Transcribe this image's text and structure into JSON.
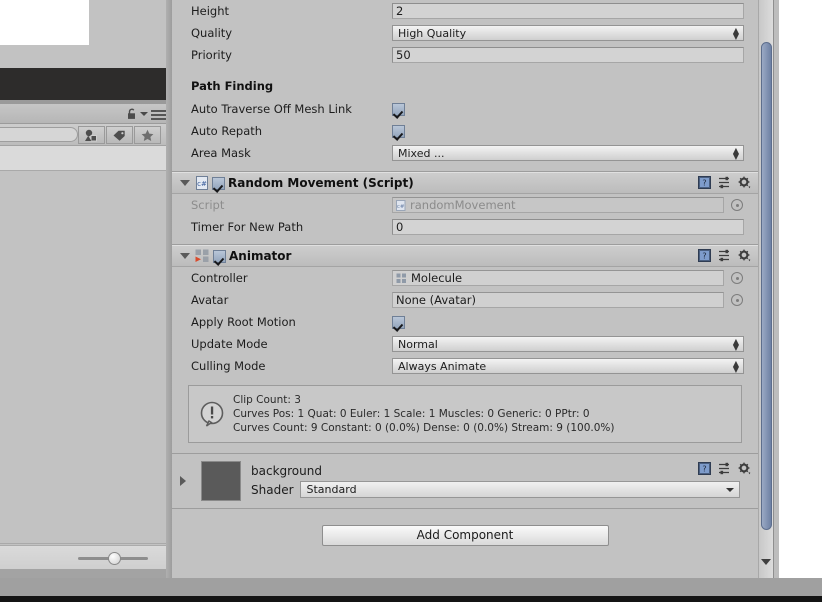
{
  "nav_mesh_agent": {
    "fields": [
      {
        "label": "Height",
        "type": "text",
        "value": "2"
      },
      {
        "label": "Quality",
        "type": "dropdown",
        "value": "High Quality"
      },
      {
        "label": "Priority",
        "type": "text",
        "value": "50"
      }
    ],
    "path_finding": {
      "section_title": "Path Finding",
      "fields": [
        {
          "label": "Auto Traverse Off Mesh Link",
          "type": "checkbox",
          "value": true
        },
        {
          "label": "Auto Repath",
          "type": "checkbox",
          "value": true
        },
        {
          "label": "Area Mask",
          "type": "dropdown",
          "value": "Mixed ..."
        }
      ]
    }
  },
  "random_movement": {
    "title": "Random Movement (Script)",
    "enabled": true,
    "icon": "csharp-script-icon",
    "fields": [
      {
        "label": "Script",
        "type": "object",
        "value": "randomMovement",
        "disabled": true
      },
      {
        "label": "Timer For New Path",
        "type": "text",
        "value": "0"
      }
    ]
  },
  "animator": {
    "title": "Animator",
    "enabled": true,
    "icon": "animator-icon",
    "fields": [
      {
        "label": "Controller",
        "type": "object",
        "value": "Molecule"
      },
      {
        "label": "Avatar",
        "type": "object",
        "value": "None (Avatar)"
      },
      {
        "label": "Apply Root Motion",
        "type": "checkbox",
        "value": true
      },
      {
        "label": "Update Mode",
        "type": "dropdown",
        "value": "Normal"
      },
      {
        "label": "Culling Mode",
        "type": "dropdown",
        "value": "Always Animate"
      }
    ],
    "info_box": {
      "icon": "warning-icon",
      "line1": "Clip Count: 3",
      "line2": "Curves Pos: 1 Quat: 0 Euler: 1 Scale: 1 Muscles: 0 Generic: 0 PPtr: 0",
      "line3": "Curves Count: 9 Constant: 0 (0.0%) Dense: 0 (0.0%) Stream: 9 (100.0%)"
    }
  },
  "material": {
    "name": "background",
    "shader_label": "Shader",
    "shader_value": "Standard"
  },
  "footer": {
    "add_component_label": "Add Component"
  },
  "component_header_icons": {
    "help": "help-book-icon",
    "preset": "preset-sliders-icon",
    "settings": "gear-icon"
  },
  "left_panel": {
    "toolbar_icons": [
      "lock-icon",
      "chevron-down-icon",
      "hamburger-menu-icon"
    ],
    "search_placeholder": "",
    "filter_buttons": [
      "type-filter-icon",
      "label-filter-icon",
      "favorites-star-icon"
    ],
    "zoom_slider_value": 43
  },
  "colors": {
    "panel_bg": "#c2c2c2",
    "field_bg": "#d3d3d3",
    "scrollbar_thumb": "#7b8daf",
    "checkbox": "#a4b4c9",
    "material_sphere": "#171c28"
  }
}
